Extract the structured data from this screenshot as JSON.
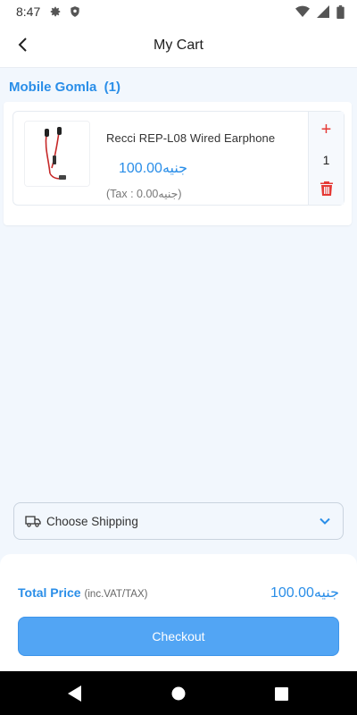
{
  "status_bar": {
    "time": "8:47",
    "icons": [
      "settings-gear-icon",
      "shield-icon",
      "wifi-icon",
      "signal-icon",
      "battery-icon"
    ]
  },
  "app_bar": {
    "title": "My Cart",
    "back_icon": "back-arrow-icon"
  },
  "store": {
    "name": "Mobile Gomla  (1)"
  },
  "cart_items": [
    {
      "name": "Recci REP-L08 Wired Earphone",
      "price": "100.00جنيه",
      "tax": "(Tax : 0.00جنيه)",
      "quantity": "1",
      "image_icon": "earphone-product-image"
    }
  ],
  "shipping": {
    "label": "Choose Shipping",
    "icon": "truck-icon",
    "dropdown_icon": "chevron-down-icon"
  },
  "summary": {
    "total_label": "Total Price",
    "total_sub": "(inc.VAT/TAX)",
    "total_value": "100.00جنيه",
    "checkout_label": "Checkout"
  },
  "colors": {
    "accent": "#2a8ee8",
    "button": "#52a5f4",
    "delete": "#e53935",
    "background": "#f2f7fd"
  }
}
